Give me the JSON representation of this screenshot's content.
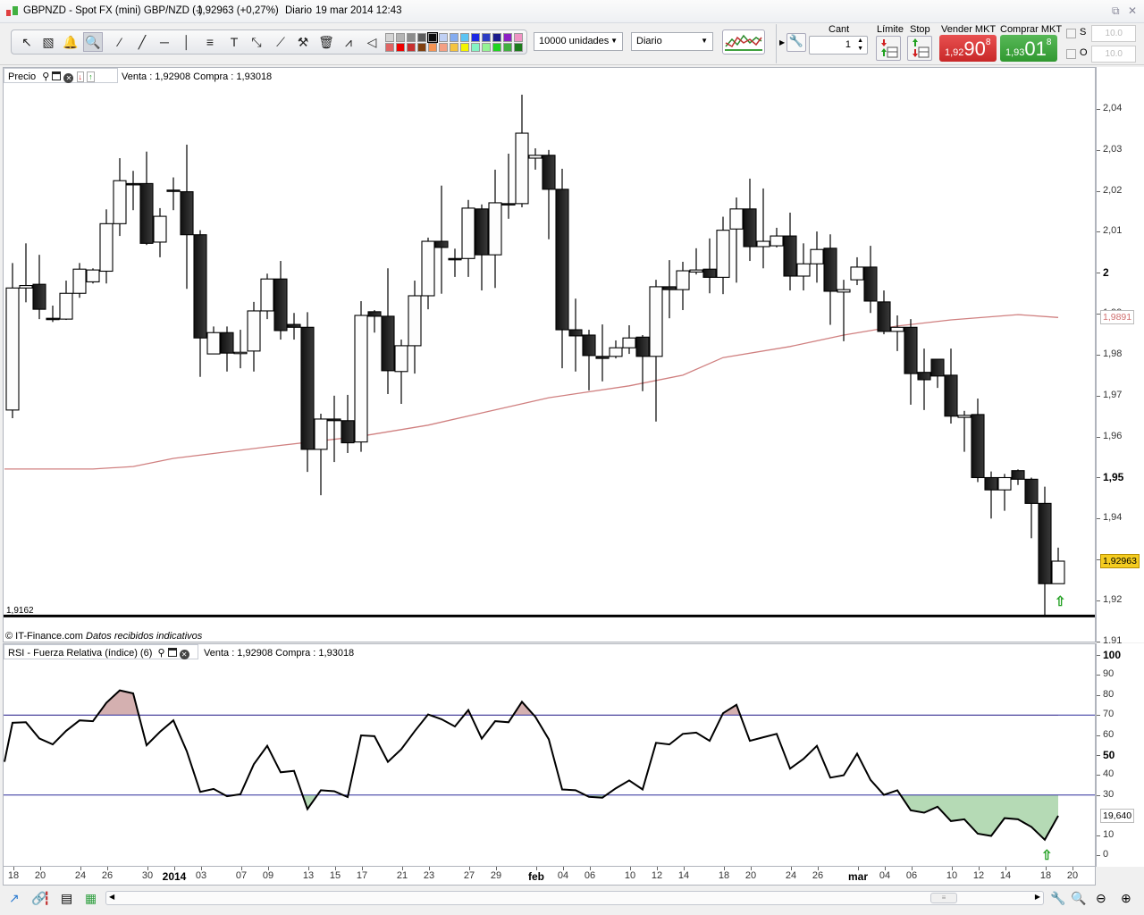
{
  "title_bar": {
    "instrument": "GBPNZD - Spot FX (mini) GBP/NZD (-)",
    "price_change": "1,92963 (+0,27%)",
    "period": "Diario",
    "datetime": "19 mar 2014 12:43",
    "restore_icon": "⧉",
    "close_icon": "✕"
  },
  "toolbar": {
    "tools": [
      "pointer-icon",
      "ruler-icon",
      "alarm-bell-icon",
      "zoom-icon",
      "segment-icon",
      "line-icon",
      "horizontal-line-icon",
      "vertical-line-icon",
      "fibonacci-icon",
      "text-icon",
      "parallel-channel-icon",
      "trendline-icon",
      "tools-icon",
      "trash-icon",
      "pattern-icon",
      "triangle-icon"
    ],
    "tool_glyphs": [
      "↖",
      "▧",
      "🔔",
      "🔍",
      "⁄",
      "╱",
      "─",
      "│",
      "≡",
      "T",
      "⤡",
      "⟋",
      "⚒",
      "🗑",
      "⩘",
      "◁"
    ],
    "palette_top": [
      "#d4d4d4",
      "#b4b4b4",
      "#8c8c8c",
      "#5c5c5c",
      "#0c0c0c",
      "#c0d0f4",
      "#84acf0",
      "#5cc4f4",
      "#1c28e4",
      "#2c3cc4",
      "#1c1c8c",
      "#8c20c4",
      "#f094c4"
    ],
    "palette_bottom": [
      "#e06464",
      "#f00000",
      "#c83030",
      "#804010",
      "#f49454",
      "#f4a084",
      "#f4c440",
      "#f4f400",
      "#84f4c4",
      "#94f494",
      "#20d420",
      "#40b040",
      "#1c7c1c"
    ],
    "quantity_select": "10000 unidades",
    "period_select": "Diario"
  },
  "trade_panel": {
    "cant_label": "Cant",
    "cant_value": "1",
    "limit_label": "Límite",
    "stop_label": "Stop",
    "sell_label": "Vender MKT",
    "sell_prefix": "1,92",
    "sell_big": "90",
    "sell_sup": "8",
    "buy_label": "Comprar MKT",
    "buy_prefix": "1,93",
    "buy_big": "01",
    "buy_sup": "8",
    "s_label": "S",
    "o_label": "O",
    "s_value": "10.0",
    "o_value": "10.0",
    "sell_color": "#d83a3a",
    "buy_color": "#3aa040"
  },
  "price_pane": {
    "title": "Precio",
    "quote": "Venta : 1,92908 Compra : 1,93018",
    "low_line_label": "1,9162",
    "footer_brand": "© IT-Finance.com",
    "footer_note": "Datos recibidos indicativos",
    "ma_label": "1,9891",
    "current_price_label": "1,92963",
    "axis_labels": [
      "2,04",
      "2,03",
      "2,02",
      "2,01",
      "2",
      "1,99",
      "1,98",
      "1,97",
      "1,96",
      "1,95",
      "1,94",
      "1,93",
      "1,92",
      "1,91"
    ]
  },
  "rsi_pane": {
    "title": "RSI - Fuerza Relativa (índice) (6)",
    "quote": "Venta : 1,92908 Compra : 1,93018",
    "current_label": "19,640",
    "axis_labels": [
      "100",
      "90",
      "80",
      "70",
      "60",
      "50",
      "40",
      "30",
      "10",
      "0"
    ]
  },
  "date_axis": [
    {
      "label": "18",
      "i": 0
    },
    {
      "label": "20",
      "i": 2
    },
    {
      "label": "24",
      "i": 5
    },
    {
      "label": "26",
      "i": 7
    },
    {
      "label": "30",
      "i": 10
    },
    {
      "label": "2014",
      "i": 12,
      "bold": true
    },
    {
      "label": "03",
      "i": 14
    },
    {
      "label": "07",
      "i": 17
    },
    {
      "label": "09",
      "i": 19
    },
    {
      "label": "13",
      "i": 22
    },
    {
      "label": "15",
      "i": 24
    },
    {
      "label": "17",
      "i": 26
    },
    {
      "label": "21",
      "i": 29
    },
    {
      "label": "23",
      "i": 31
    },
    {
      "label": "27",
      "i": 34
    },
    {
      "label": "29",
      "i": 36
    },
    {
      "label": "feb",
      "i": 39,
      "bold": true
    },
    {
      "label": "04",
      "i": 41
    },
    {
      "label": "06",
      "i": 43
    },
    {
      "label": "10",
      "i": 46
    },
    {
      "label": "12",
      "i": 48
    },
    {
      "label": "14",
      "i": 50
    },
    {
      "label": "18",
      "i": 53
    },
    {
      "label": "20",
      "i": 55
    },
    {
      "label": "24",
      "i": 58
    },
    {
      "label": "26",
      "i": 60
    },
    {
      "label": "mar",
      "i": 63,
      "bold": true
    },
    {
      "label": "04",
      "i": 65
    },
    {
      "label": "06",
      "i": 67
    },
    {
      "label": "10",
      "i": 70
    },
    {
      "label": "12",
      "i": 72
    },
    {
      "label": "14",
      "i": 74
    },
    {
      "label": "18",
      "i": 77
    },
    {
      "label": "20",
      "i": 79
    }
  ],
  "chart_data": {
    "type": "candlestick",
    "title": "GBPNZD Diario",
    "ylim": [
      1.91,
      2.045
    ],
    "low_line": 1.9162,
    "ohlc": [
      [
        1.9665,
        2.0024,
        1.9645,
        1.9963
      ],
      [
        1.9963,
        2.0072,
        1.9928,
        1.9969
      ],
      [
        1.9972,
        2.0044,
        1.9887,
        1.9911
      ],
      [
        1.9889,
        1.992,
        1.988,
        1.9889
      ],
      [
        1.9887,
        1.9981,
        1.9885,
        1.995
      ],
      [
        1.995,
        2.0024,
        1.9939,
        2.0009
      ],
      [
        1.9978,
        2.0011,
        1.9974,
        2.0007
      ],
      [
        2.0004,
        2.0155,
        1.9974,
        2.012
      ],
      [
        2.012,
        2.028,
        2.009,
        2.0225
      ],
      [
        2.0218,
        2.0249,
        2.0153,
        2.0218
      ],
      [
        2.0218,
        2.0296,
        2.0068,
        2.0072
      ],
      [
        2.0075,
        2.0158,
        2.0038,
        2.0138
      ],
      [
        2.0202,
        2.0233,
        2.0153,
        2.0202
      ],
      [
        2.0198,
        2.0313,
        1.9961,
        2.0093
      ],
      [
        2.0093,
        2.0104,
        1.9746,
        1.9841
      ],
      [
        1.9802,
        1.9869,
        1.9802,
        1.9854
      ],
      [
        1.9854,
        1.9869,
        1.9759,
        1.9804
      ],
      [
        1.9804,
        1.9861,
        1.9767,
        1.9806
      ],
      [
        1.9809,
        1.9929,
        1.9759,
        1.9907
      ],
      [
        1.9907,
        1.9998,
        1.9887,
        1.9985
      ],
      [
        1.9985,
        2.0029,
        1.9837,
        1.9859
      ],
      [
        1.9874,
        1.9902,
        1.9837,
        1.9867
      ],
      [
        1.9867,
        1.9904,
        1.9514,
        1.9569
      ],
      [
        1.9569,
        1.9656,
        1.9457,
        1.9643
      ],
      [
        1.9643,
        1.97,
        1.9538,
        1.9639
      ],
      [
        1.9639,
        1.9702,
        1.956,
        1.9585
      ],
      [
        1.9587,
        1.9931,
        1.9563,
        1.9896
      ],
      [
        1.9905,
        1.9909,
        1.9854,
        1.9894
      ],
      [
        1.9894,
        2.0011,
        1.9704,
        1.9761
      ],
      [
        1.9759,
        1.9837,
        1.968,
        1.9822
      ],
      [
        1.9822,
        1.9981,
        1.9754,
        1.9944
      ],
      [
        1.9944,
        2.0086,
        1.9911,
        2.0077
      ],
      [
        2.0077,
        2.0213,
        1.9949,
        2.0062
      ],
      [
        2.0035,
        2.0059,
        1.999,
        2.0035
      ],
      [
        2.0035,
        2.0178,
        1.999,
        2.0158
      ],
      [
        2.0156,
        2.0167,
        1.9957,
        2.0044
      ],
      [
        2.0044,
        2.0252,
        1.9963,
        2.0171
      ],
      [
        2.0169,
        2.0291,
        2.0132,
        2.0169
      ],
      [
        2.0169,
        2.0435,
        2.016,
        2.0341
      ],
      [
        2.028,
        2.0304,
        2.0252,
        2.0287
      ],
      [
        2.0287,
        2.03,
        2.0082,
        2.0204
      ],
      [
        2.0204,
        2.0254,
        1.9767,
        1.9861
      ],
      [
        1.9861,
        1.9937,
        1.9759,
        1.9846
      ],
      [
        1.9848,
        1.9861,
        1.9713,
        1.9798
      ],
      [
        1.9796,
        1.9874,
        1.9735,
        1.9791
      ],
      [
        1.9796,
        1.9835,
        1.9791,
        1.9817
      ],
      [
        1.9817,
        1.9872,
        1.9802,
        1.9841
      ],
      [
        1.9843,
        1.9848,
        1.9711,
        1.9796
      ],
      [
        1.9796,
        1.9983,
        1.9637,
        1.9966
      ],
      [
        1.9966,
        2.0031,
        1.9889,
        1.9959
      ],
      [
        1.9959,
        2.0027,
        1.9909,
        2.0005
      ],
      [
        2.0002,
        2.006,
        1.9996,
        2.0007
      ],
      [
        2.0009,
        2.0084,
        1.995,
        1.9989
      ],
      [
        1.9989,
        2.0137,
        1.9948,
        2.0104
      ],
      [
        2.0107,
        2.0184,
        1.9976,
        2.0156
      ],
      [
        2.0156,
        2.023,
        2.0029,
        2.0064
      ],
      [
        2.0064,
        2.0206,
        2.0011,
        2.0077
      ],
      [
        2.0066,
        2.011,
        2.0062,
        2.009
      ],
      [
        2.009,
        2.0147,
        1.9957,
        1.9992
      ],
      [
        1.9992,
        2.0072,
        1.9957,
        2.0022
      ],
      [
        2.0022,
        2.0101,
        1.9976,
        2.0057
      ],
      [
        2.006,
        2.0094,
        1.9873,
        1.9955
      ],
      [
        1.9953,
        1.9983,
        1.9833,
        1.9959
      ],
      [
        1.9983,
        2.0038,
        1.997,
        2.0014
      ],
      [
        2.0014,
        2.0066,
        1.9902,
        1.9931
      ],
      [
        1.9929,
        1.9957,
        1.985,
        1.9857
      ],
      [
        1.9857,
        1.9896,
        1.9809,
        1.9867
      ],
      [
        1.9867,
        1.9887,
        1.9678,
        1.9754
      ],
      [
        1.9757,
        1.9815,
        1.9665,
        1.9739
      ],
      [
        1.9789,
        1.9789,
        1.9719,
        1.9748
      ],
      [
        1.975,
        1.9815,
        1.9632,
        1.965
      ],
      [
        1.9647,
        1.9663,
        1.9563,
        1.9652
      ],
      [
        1.9654,
        1.9693,
        1.9489,
        1.95
      ],
      [
        1.95,
        1.9515,
        1.94,
        1.947
      ],
      [
        1.947,
        1.9509,
        1.9419,
        1.95
      ],
      [
        1.9517,
        1.952,
        1.9482,
        1.9496
      ],
      [
        1.9496,
        1.95,
        1.9352,
        1.9437
      ],
      [
        1.9437,
        1.9478,
        1.9162,
        1.9241
      ],
      [
        1.9241,
        1.9329,
        1.9241,
        1.9296
      ]
    ],
    "ma": [
      [
        -0.6,
        1.9521
      ],
      [
        6,
        1.9521
      ],
      [
        9,
        1.9527
      ],
      [
        12,
        1.9547
      ],
      [
        19,
        1.9575
      ],
      [
        26,
        1.9601
      ],
      [
        31,
        1.9628
      ],
      [
        35,
        1.9658
      ],
      [
        40,
        1.9695
      ],
      [
        46,
        1.9724
      ],
      [
        50,
        1.975
      ],
      [
        53,
        1.9793
      ],
      [
        58,
        1.982
      ],
      [
        62,
        1.9848
      ],
      [
        66,
        1.987
      ],
      [
        70,
        1.9885
      ],
      [
        75,
        1.9898
      ],
      [
        78,
        1.9891
      ]
    ],
    "ma_color": "#d08080",
    "rsi": {
      "period": 6,
      "overbought": 70,
      "oversold": 30,
      "ylim": [
        0,
        100
      ],
      "left_edge_value": 46.6,
      "values": [
        66.1,
        66.4,
        58.3,
        55.3,
        62.1,
        67.3,
        66.9,
        76.1,
        82.3,
        80.8,
        54.9,
        61.6,
        67.3,
        51.9,
        31.6,
        33.1,
        29.4,
        30.4,
        45.4,
        54.6,
        41.4,
        42.1,
        23.0,
        32.4,
        31.9,
        29.0,
        59.8,
        59.4,
        46.6,
        52.9,
        61.9,
        70.3,
        67.9,
        64.3,
        72.5,
        58.2,
        66.9,
        66.4,
        76.6,
        69.1,
        57.9,
        32.8,
        32.4,
        29.1,
        28.7,
        33.4,
        37.3,
        32.8,
        56.1,
        55.3,
        60.6,
        61.2,
        57.1,
        70.9,
        75.1,
        57.1,
        58.9,
        60.6,
        43.2,
        48.1,
        54.6,
        38.7,
        39.9,
        50.7,
        37.6,
        30.1,
        32.4,
        22.4,
        21.2,
        24.2,
        17.0,
        17.9,
        10.7,
        9.6,
        18.5,
        17.9,
        14.1,
        7.7,
        19.64
      ],
      "overbought_fill": "#d4b0b0",
      "oversold_fill": "#b5dab5",
      "level_color": "#2a2a9a"
    }
  }
}
